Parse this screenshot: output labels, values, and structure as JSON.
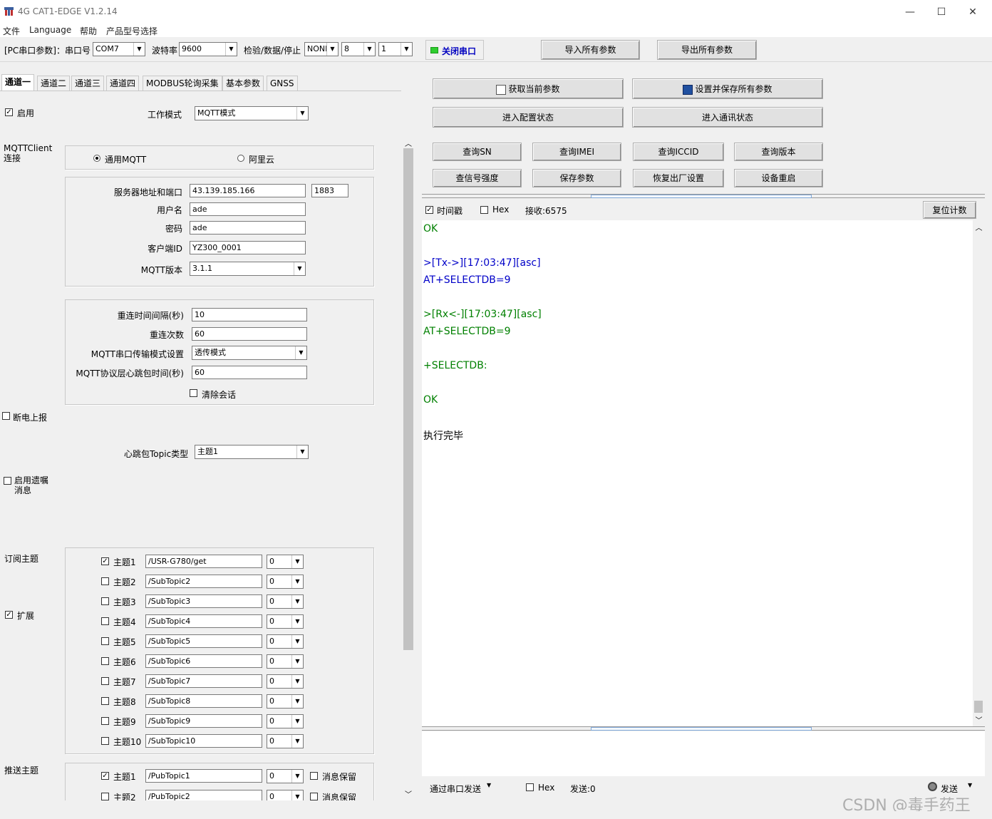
{
  "window": {
    "title": "4G CAT1-EDGE V1.2.14",
    "controls": [
      "—",
      "☐",
      "✕"
    ]
  },
  "menu": [
    "文件",
    "Language",
    "帮助",
    "产品型号选择"
  ],
  "toolbar": {
    "port_label": "[PC串口参数]：串口号",
    "port_value": "COM7",
    "baud_label": "波特率",
    "baud_value": "9600",
    "check_label": "检验/数据/停止",
    "parity_value": "NONI",
    "databits_value": "8",
    "stopbits_value": "1",
    "close_port": "关闭串口",
    "import_all": "导入所有参数",
    "export_all": "导出所有参数"
  },
  "tabs": [
    "通道一",
    "通道二",
    "通道三",
    "通道四",
    "MODBUS轮询采集",
    "基本参数",
    "GNSS"
  ],
  "channel": {
    "enable_label": "启用",
    "work_mode_label": "工作模式",
    "work_mode_value": "MQTT模式",
    "mqtt_client_label": "MQTTClient\n连接",
    "radio_generic": "通用MQTT",
    "radio_aliyun": "阿里云",
    "server_label": "服务器地址和端口",
    "server_value": "43.139.185.166",
    "port_value": "1883",
    "username_label": "用户名",
    "username_value": "ade",
    "password_label": "密码",
    "password_value": "ade",
    "clientid_label": "客户端ID",
    "clientid_value": "YZ300_0001",
    "mqtt_version_label": "MQTT版本",
    "mqtt_version_value": "3.1.1",
    "reconnect_interval_label": "重连时间间隔(秒)",
    "reconnect_interval_value": "10",
    "reconnect_count_label": "重连次数",
    "reconnect_count_value": "60",
    "transfer_mode_label": "MQTT串口传输模式设置",
    "transfer_mode_value": "透传模式",
    "keepalive_label": "MQTT协议层心跳包时间(秒)",
    "keepalive_value": "60",
    "clean_session_label": "清除会话",
    "power_report_label": "断电上报",
    "heartbeat_topic_label": "心跳包Topic类型",
    "heartbeat_topic_value": "主题1",
    "will_label": "启用遗嘱\n消息",
    "subscribe_label": "订阅主题",
    "extend_label": "扩展",
    "publish_label": "推送主题",
    "retain_label": "消息保留",
    "sub_topics": [
      {
        "name": "主题1",
        "value": "/USR-G780/get",
        "qos": "0",
        "checked": true
      },
      {
        "name": "主题2",
        "value": "/SubTopic2",
        "qos": "0",
        "checked": false
      },
      {
        "name": "主题3",
        "value": "/SubTopic3",
        "qos": "0",
        "checked": false
      },
      {
        "name": "主题4",
        "value": "/SubTopic4",
        "qos": "0",
        "checked": false
      },
      {
        "name": "主题5",
        "value": "/SubTopic5",
        "qos": "0",
        "checked": false
      },
      {
        "name": "主题6",
        "value": "/SubTopic6",
        "qos": "0",
        "checked": false
      },
      {
        "name": "主题7",
        "value": "/SubTopic7",
        "qos": "0",
        "checked": false
      },
      {
        "name": "主题8",
        "value": "/SubTopic8",
        "qos": "0",
        "checked": false
      },
      {
        "name": "主题9",
        "value": "/SubTopic9",
        "qos": "0",
        "checked": false
      },
      {
        "name": "主题10",
        "value": "/SubTopic10",
        "qos": "0",
        "checked": false
      }
    ],
    "pub_topics": [
      {
        "name": "主题1",
        "value": "/PubTopic1",
        "qos": "0",
        "checked": true
      },
      {
        "name": "主题2",
        "value": "/PubTopic2",
        "qos": "0",
        "checked": false
      }
    ]
  },
  "right": {
    "get_params": "获取当前参数",
    "set_save_params": "设置并保存所有参数",
    "enter_config": "进入配置状态",
    "enter_comm": "进入通讯状态",
    "query_sn": "查询SN",
    "query_imei": "查询IMEI",
    "query_iccid": "查询ICCID",
    "query_version": "查询版本",
    "query_signal": "查信号强度",
    "save_params": "保存参数",
    "factory_reset": "恢复出厂设置",
    "device_restart": "设备重启",
    "timestamp_label": "时间戳",
    "hex_label": "Hex",
    "recv_label": "接收:6575",
    "reset_count": "复位计数",
    "log": [
      {
        "text": "OK",
        "color": "green"
      },
      {
        "text": ">[Tx->][17:03:47][asc]",
        "color": "blue"
      },
      {
        "text": "AT+SELECTDB=9",
        "color": "blue"
      },
      {
        "text": ">[Rx<-][17:03:47][asc]",
        "color": "green"
      },
      {
        "text": "AT+SELECTDB=9",
        "color": "green"
      },
      {
        "text": "+SELECTDB:",
        "color": "green"
      },
      {
        "text": "OK",
        "color": "green"
      },
      {
        "text": "执行完毕",
        "color": "black"
      }
    ],
    "send_via": "通过串口发送",
    "send_hex": "Hex",
    "sent_count": "发送:0",
    "send_button": "发送",
    "watermark": "CSDN @毒手药王"
  }
}
